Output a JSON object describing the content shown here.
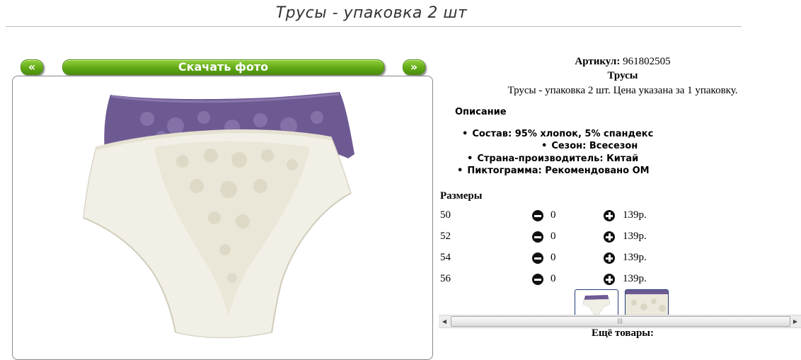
{
  "page": {
    "title": "Трусы - упаковка 2 шт"
  },
  "gallery": {
    "prev_label": "«",
    "download_label": "Скачать фото",
    "next_label": "»"
  },
  "product": {
    "article_label": "Артикул:",
    "article_value": "961802505",
    "name": "Трусы",
    "description": "Трусы - упаковка 2 шт. Цена указана за 1 упаковку.",
    "description_heading": "Описание",
    "features": [
      "Состав: 95% хлопок, 5% спандекс",
      "Сезон: Всесезон",
      "Страна-производитель: Китай",
      "Пиктограмма: Рекомендовано ОМ"
    ],
    "sizes_heading": "Размеры",
    "sizes": [
      {
        "size": "50",
        "qty": "0",
        "price": "139р."
      },
      {
        "size": "52",
        "qty": "0",
        "price": "139р."
      },
      {
        "size": "54",
        "qty": "0",
        "price": "139р."
      },
      {
        "size": "56",
        "qty": "0",
        "price": "139р."
      }
    ]
  },
  "more_products": {
    "heading": "Ещё товары:"
  },
  "colors": {
    "button_green": "#5fa614",
    "link_green": "#3a9a1e",
    "purple": "#6e5a93",
    "cream": "#f2f0e6"
  }
}
